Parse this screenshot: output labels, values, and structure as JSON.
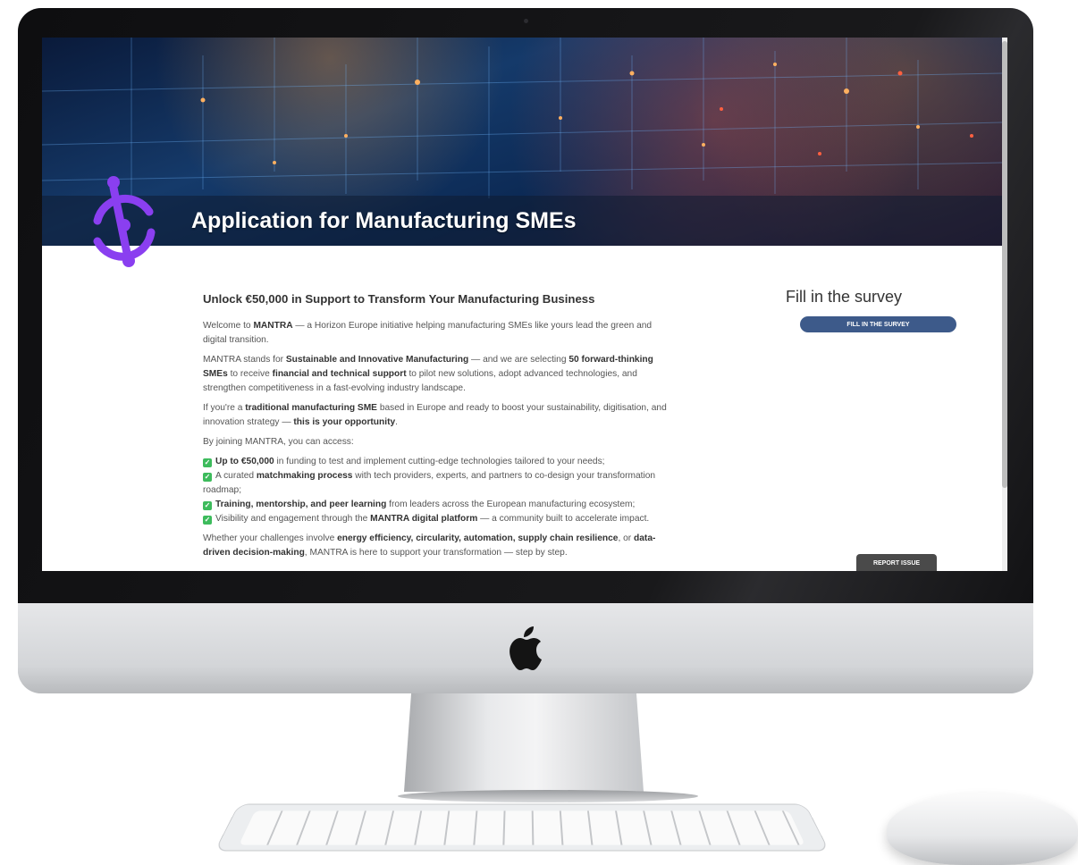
{
  "hero": {
    "title": "Application for Manufacturing SMEs"
  },
  "article": {
    "heading": "Unlock €50,000 in Support to Transform Your Manufacturing Business",
    "p1": {
      "a": "Welcome to ",
      "b": "MANTRA",
      "c": " — a Horizon Europe initiative helping manufacturing SMEs like yours lead the green and digital transition."
    },
    "p2": {
      "a": "MANTRA stands for ",
      "b": "Sustainable and Innovative Manufacturing",
      "c": " — and we are selecting ",
      "d": "50 forward-thinking SMEs",
      "e": " to receive ",
      "f": "financial and technical support",
      "g": " to pilot new solutions, adopt advanced technologies, and strengthen competitiveness in a fast-evolving industry landscape."
    },
    "p3": {
      "a": "If you're a ",
      "b": "traditional manufacturing SME",
      "c": " based in Europe and ready to boost your sustainability, digitisation, and innovation strategy — ",
      "d": "this is your opportunity",
      "e": "."
    },
    "p4": "By joining MANTRA, you can access:",
    "benefits": [
      {
        "bold": "Up to €50,000",
        "text": " in funding to test and implement cutting-edge technologies tailored to your needs;"
      },
      {
        "pre": "A curated ",
        "bold": "matchmaking process",
        "text": " with tech providers, experts, and partners to co-design your transformation roadmap;"
      },
      {
        "bold": "Training, mentorship, and peer learning",
        "text": " from leaders across the European manufacturing ecosystem;"
      },
      {
        "pre": "Visibility and engagement through the ",
        "bold": "MANTRA digital platform",
        "text": " — a community built to accelerate impact."
      }
    ],
    "p5": {
      "a": "Whether your challenges involve ",
      "b": "energy efficiency, circularity, automation, supply chain resilience",
      "c": ", or ",
      "d": "data-driven decision-making",
      "e": ", MANTRA is here to support your transformation — step by step."
    }
  },
  "aside": {
    "heading": "Fill in the survey",
    "button_label": "FILL IN THE SURVEY"
  },
  "report_label": "REPORT ISSUE",
  "colors": {
    "brand_purple": "#8a3ff0",
    "survey_button": "#3d5a8a",
    "check_green": "#3dbb5c"
  }
}
